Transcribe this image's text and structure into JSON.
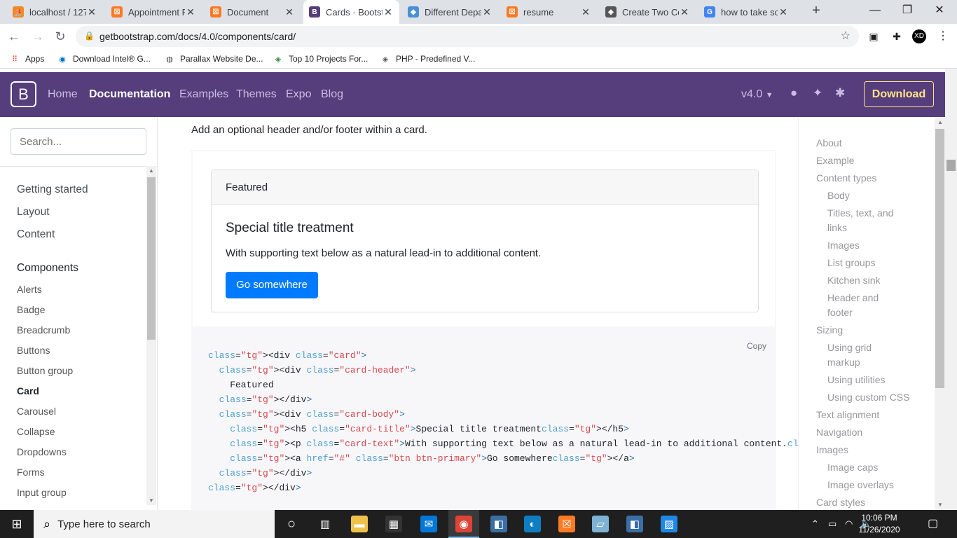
{
  "browser": {
    "tabs": [
      {
        "title": "localhost / 127",
        "fav": "phpmyadmin-icon",
        "color": "#f08a24",
        "glyph": "⛵"
      },
      {
        "title": "Appointment F",
        "fav": "xampp-icon",
        "color": "#fb7a24",
        "glyph": "☒"
      },
      {
        "title": "Document",
        "fav": "xampp-icon",
        "color": "#fb7a24",
        "glyph": "☒"
      },
      {
        "title": "Cards · Bootstr",
        "fav": "bootstrap-icon",
        "color": "#563d7c",
        "glyph": "B"
      },
      {
        "title": "Different Depa",
        "fav": "site-icon",
        "color": "#4a90d9",
        "glyph": "◆"
      },
      {
        "title": "resume",
        "fav": "xampp-icon",
        "color": "#fb7a24",
        "glyph": "☒"
      },
      {
        "title": "Create Two Co",
        "fav": "site-icon",
        "color": "#555555",
        "glyph": "◈"
      },
      {
        "title": "how to take sc",
        "fav": "google-icon",
        "color": "#4285f4",
        "glyph": "G"
      }
    ],
    "active_tab": 3,
    "url": "getbootstrap.com/docs/4.0/components/card/",
    "bookmarks": [
      {
        "label": "Apps",
        "icon": "apps-grid-icon"
      },
      {
        "label": "Download Intel® G...",
        "icon": "intel-icon"
      },
      {
        "label": "Parallax Website De...",
        "icon": "globe-icon"
      },
      {
        "label": "Top 10 Projects For...",
        "icon": "site-icon"
      },
      {
        "label": "PHP - Predefined V...",
        "icon": "site-icon"
      }
    ]
  },
  "navbar": {
    "links": [
      "Home",
      "Documentation",
      "Examples",
      "Themes",
      "Expo",
      "Blog"
    ],
    "active": "Documentation",
    "version": "v4.0",
    "download_label": "Download",
    "brand_color": "#563d7c",
    "accent_color": "#ffe484"
  },
  "sidebar": {
    "search_placeholder": "Search...",
    "sections": [
      "Getting started",
      "Layout",
      "Content",
      "Components"
    ],
    "components": [
      "Alerts",
      "Badge",
      "Breadcrumb",
      "Buttons",
      "Button group",
      "Card",
      "Carousel",
      "Collapse",
      "Dropdowns",
      "Forms",
      "Input group"
    ],
    "current": "Card"
  },
  "main": {
    "intro": "Add an optional header and/or footer within a card.",
    "card": {
      "header": "Featured",
      "title": "Special title treatment",
      "text": "With supporting text below as a natural lead-in to additional content.",
      "button": "Go somewhere"
    },
    "copy_label": "Copy",
    "code_lines": [
      "<div class=\"card\">",
      "  <div class=\"card-header\">",
      "    Featured",
      "  </div>",
      "  <div class=\"card-body\">",
      "    <h5 class=\"card-title\">Special title treatment</h5>",
      "    <p class=\"card-text\">With supporting text below as a natural lead-in to additional content.</p>",
      "    <a href=\"#\" class=\"btn btn-primary\">Go somewhere</a>",
      "  </div>",
      "</div>"
    ]
  },
  "toc": [
    {
      "label": "About",
      "level": 0
    },
    {
      "label": "Example",
      "level": 0
    },
    {
      "label": "Content types",
      "level": 0
    },
    {
      "label": "Body",
      "level": 1
    },
    {
      "label": "Titles, text, and",
      "level": 1
    },
    {
      "label": "links",
      "level": 1
    },
    {
      "label": "Images",
      "level": 1
    },
    {
      "label": "List groups",
      "level": 1
    },
    {
      "label": "Kitchen sink",
      "level": 1
    },
    {
      "label": "Header and",
      "level": 1
    },
    {
      "label": "footer",
      "level": 1
    },
    {
      "label": "Sizing",
      "level": 0
    },
    {
      "label": "Using grid",
      "level": 1
    },
    {
      "label": "markup",
      "level": 1
    },
    {
      "label": "Using utilities",
      "level": 1
    },
    {
      "label": "Using custom CSS",
      "level": 1
    },
    {
      "label": "Text alignment",
      "level": 0
    },
    {
      "label": "Navigation",
      "level": 0
    },
    {
      "label": "Images",
      "level": 0
    },
    {
      "label": "Image caps",
      "level": 1
    },
    {
      "label": "Image overlays",
      "level": 1
    },
    {
      "label": "Card styles",
      "level": 0
    }
  ],
  "taskbar": {
    "search_placeholder": "Type here to search",
    "time": "10:06 PM",
    "date": "11/26/2020",
    "apps": [
      "task-view-icon",
      "file-explorer-icon",
      "store-icon",
      "mail-icon",
      "chrome-icon",
      "app-icon",
      "edge-icon",
      "xampp-icon",
      "notepad-icon",
      "app-icon",
      "photos-icon"
    ]
  }
}
